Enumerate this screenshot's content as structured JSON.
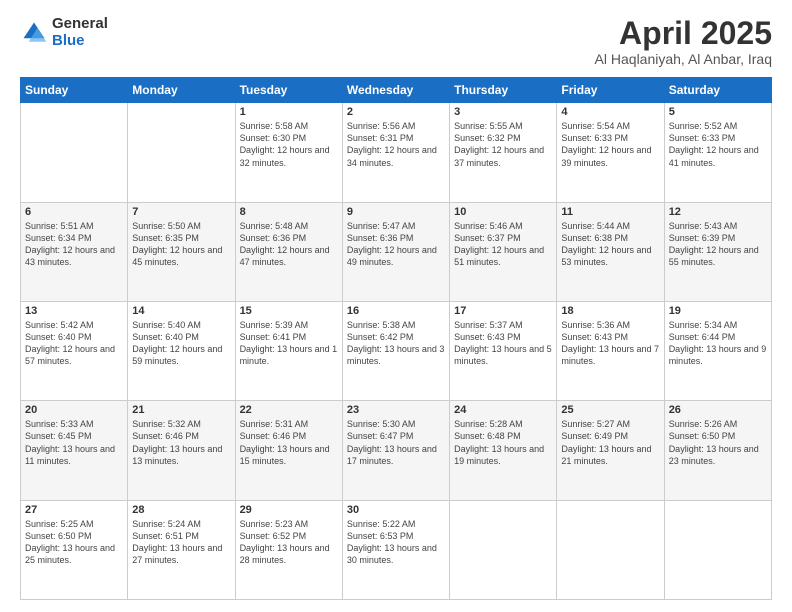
{
  "header": {
    "logo_general": "General",
    "logo_blue": "Blue",
    "month_title": "April 2025",
    "location": "Al Haqlaniyah, Al Anbar, Iraq"
  },
  "days_of_week": [
    "Sunday",
    "Monday",
    "Tuesday",
    "Wednesday",
    "Thursday",
    "Friday",
    "Saturday"
  ],
  "weeks": [
    [
      {
        "day": "",
        "sunrise": "",
        "sunset": "",
        "daylight": ""
      },
      {
        "day": "",
        "sunrise": "",
        "sunset": "",
        "daylight": ""
      },
      {
        "day": "1",
        "sunrise": "Sunrise: 5:58 AM",
        "sunset": "Sunset: 6:30 PM",
        "daylight": "Daylight: 12 hours and 32 minutes."
      },
      {
        "day": "2",
        "sunrise": "Sunrise: 5:56 AM",
        "sunset": "Sunset: 6:31 PM",
        "daylight": "Daylight: 12 hours and 34 minutes."
      },
      {
        "day": "3",
        "sunrise": "Sunrise: 5:55 AM",
        "sunset": "Sunset: 6:32 PM",
        "daylight": "Daylight: 12 hours and 37 minutes."
      },
      {
        "day": "4",
        "sunrise": "Sunrise: 5:54 AM",
        "sunset": "Sunset: 6:33 PM",
        "daylight": "Daylight: 12 hours and 39 minutes."
      },
      {
        "day": "5",
        "sunrise": "Sunrise: 5:52 AM",
        "sunset": "Sunset: 6:33 PM",
        "daylight": "Daylight: 12 hours and 41 minutes."
      }
    ],
    [
      {
        "day": "6",
        "sunrise": "Sunrise: 5:51 AM",
        "sunset": "Sunset: 6:34 PM",
        "daylight": "Daylight: 12 hours and 43 minutes."
      },
      {
        "day": "7",
        "sunrise": "Sunrise: 5:50 AM",
        "sunset": "Sunset: 6:35 PM",
        "daylight": "Daylight: 12 hours and 45 minutes."
      },
      {
        "day": "8",
        "sunrise": "Sunrise: 5:48 AM",
        "sunset": "Sunset: 6:36 PM",
        "daylight": "Daylight: 12 hours and 47 minutes."
      },
      {
        "day": "9",
        "sunrise": "Sunrise: 5:47 AM",
        "sunset": "Sunset: 6:36 PM",
        "daylight": "Daylight: 12 hours and 49 minutes."
      },
      {
        "day": "10",
        "sunrise": "Sunrise: 5:46 AM",
        "sunset": "Sunset: 6:37 PM",
        "daylight": "Daylight: 12 hours and 51 minutes."
      },
      {
        "day": "11",
        "sunrise": "Sunrise: 5:44 AM",
        "sunset": "Sunset: 6:38 PM",
        "daylight": "Daylight: 12 hours and 53 minutes."
      },
      {
        "day": "12",
        "sunrise": "Sunrise: 5:43 AM",
        "sunset": "Sunset: 6:39 PM",
        "daylight": "Daylight: 12 hours and 55 minutes."
      }
    ],
    [
      {
        "day": "13",
        "sunrise": "Sunrise: 5:42 AM",
        "sunset": "Sunset: 6:40 PM",
        "daylight": "Daylight: 12 hours and 57 minutes."
      },
      {
        "day": "14",
        "sunrise": "Sunrise: 5:40 AM",
        "sunset": "Sunset: 6:40 PM",
        "daylight": "Daylight: 12 hours and 59 minutes."
      },
      {
        "day": "15",
        "sunrise": "Sunrise: 5:39 AM",
        "sunset": "Sunset: 6:41 PM",
        "daylight": "Daylight: 13 hours and 1 minute."
      },
      {
        "day": "16",
        "sunrise": "Sunrise: 5:38 AM",
        "sunset": "Sunset: 6:42 PM",
        "daylight": "Daylight: 13 hours and 3 minutes."
      },
      {
        "day": "17",
        "sunrise": "Sunrise: 5:37 AM",
        "sunset": "Sunset: 6:43 PM",
        "daylight": "Daylight: 13 hours and 5 minutes."
      },
      {
        "day": "18",
        "sunrise": "Sunrise: 5:36 AM",
        "sunset": "Sunset: 6:43 PM",
        "daylight": "Daylight: 13 hours and 7 minutes."
      },
      {
        "day": "19",
        "sunrise": "Sunrise: 5:34 AM",
        "sunset": "Sunset: 6:44 PM",
        "daylight": "Daylight: 13 hours and 9 minutes."
      }
    ],
    [
      {
        "day": "20",
        "sunrise": "Sunrise: 5:33 AM",
        "sunset": "Sunset: 6:45 PM",
        "daylight": "Daylight: 13 hours and 11 minutes."
      },
      {
        "day": "21",
        "sunrise": "Sunrise: 5:32 AM",
        "sunset": "Sunset: 6:46 PM",
        "daylight": "Daylight: 13 hours and 13 minutes."
      },
      {
        "day": "22",
        "sunrise": "Sunrise: 5:31 AM",
        "sunset": "Sunset: 6:46 PM",
        "daylight": "Daylight: 13 hours and 15 minutes."
      },
      {
        "day": "23",
        "sunrise": "Sunrise: 5:30 AM",
        "sunset": "Sunset: 6:47 PM",
        "daylight": "Daylight: 13 hours and 17 minutes."
      },
      {
        "day": "24",
        "sunrise": "Sunrise: 5:28 AM",
        "sunset": "Sunset: 6:48 PM",
        "daylight": "Daylight: 13 hours and 19 minutes."
      },
      {
        "day": "25",
        "sunrise": "Sunrise: 5:27 AM",
        "sunset": "Sunset: 6:49 PM",
        "daylight": "Daylight: 13 hours and 21 minutes."
      },
      {
        "day": "26",
        "sunrise": "Sunrise: 5:26 AM",
        "sunset": "Sunset: 6:50 PM",
        "daylight": "Daylight: 13 hours and 23 minutes."
      }
    ],
    [
      {
        "day": "27",
        "sunrise": "Sunrise: 5:25 AM",
        "sunset": "Sunset: 6:50 PM",
        "daylight": "Daylight: 13 hours and 25 minutes."
      },
      {
        "day": "28",
        "sunrise": "Sunrise: 5:24 AM",
        "sunset": "Sunset: 6:51 PM",
        "daylight": "Daylight: 13 hours and 27 minutes."
      },
      {
        "day": "29",
        "sunrise": "Sunrise: 5:23 AM",
        "sunset": "Sunset: 6:52 PM",
        "daylight": "Daylight: 13 hours and 28 minutes."
      },
      {
        "day": "30",
        "sunrise": "Sunrise: 5:22 AM",
        "sunset": "Sunset: 6:53 PM",
        "daylight": "Daylight: 13 hours and 30 minutes."
      },
      {
        "day": "",
        "sunrise": "",
        "sunset": "",
        "daylight": ""
      },
      {
        "day": "",
        "sunrise": "",
        "sunset": "",
        "daylight": ""
      },
      {
        "day": "",
        "sunrise": "",
        "sunset": "",
        "daylight": ""
      }
    ]
  ]
}
